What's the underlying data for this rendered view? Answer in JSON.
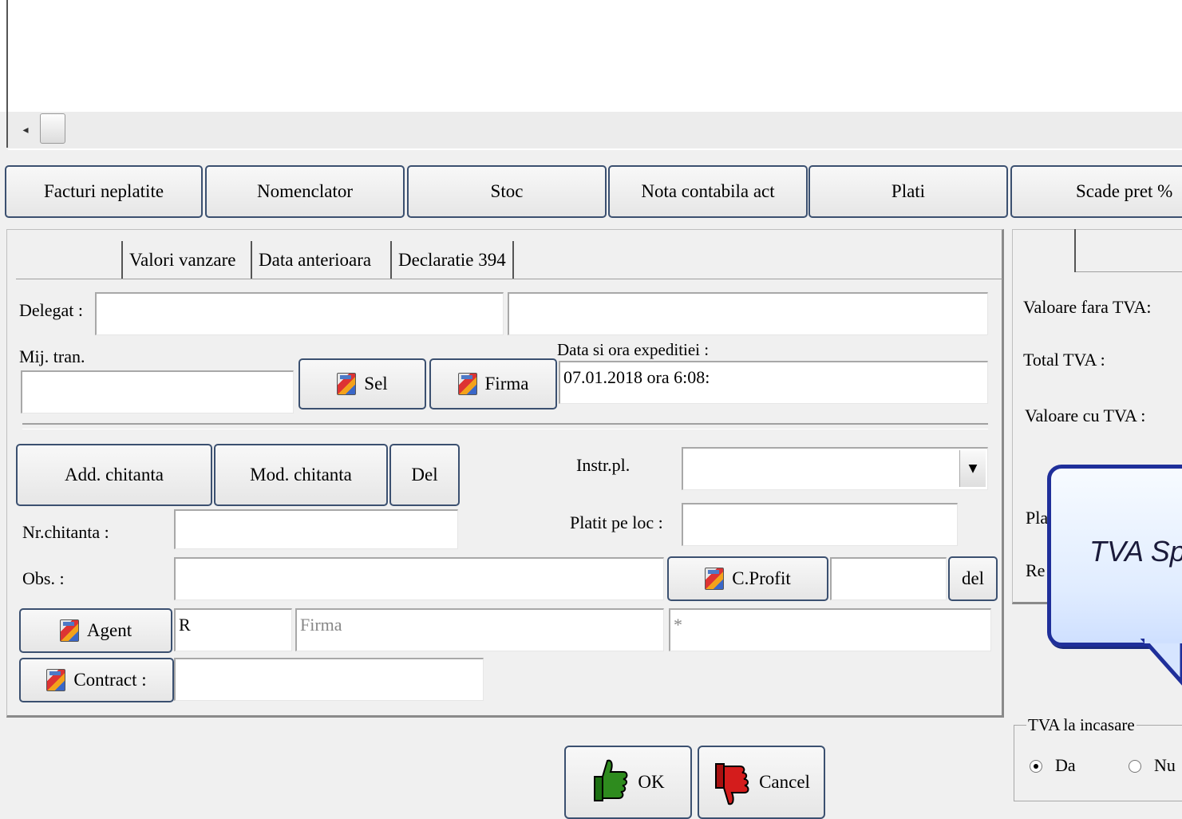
{
  "scrollbar": {
    "left_arrow_icon": "arrow-left-icon"
  },
  "toolbar": {
    "buttons": [
      "Facturi neplatite",
      "Nomenclator",
      "Stoc",
      "Nota contabila act",
      "Plati",
      "Scade pret %"
    ]
  },
  "tabs": [
    "Valori vanzare",
    "Data anterioara",
    "Declaratie 394"
  ],
  "form": {
    "delegat_label": "Delegat :",
    "delegat_value": "",
    "delegat_value2": "",
    "mij_tran_label": "Mij. tran.",
    "mij_tran_value": "",
    "sel_button": "Sel",
    "firma_button": "Firma",
    "data_expeditie_label": "Data si ora expeditiei :",
    "data_expeditie_value": "07.01.2018 ora 6:08:",
    "add_chitanta": "Add. chitanta",
    "mod_chitanta": "Mod. chitanta",
    "del_button": "Del",
    "instr_pl_label": "Instr.pl.",
    "instr_pl_value": "",
    "platit_pe_loc_label": "Platit pe loc :",
    "platit_pe_loc_value": "",
    "nr_chitanta_label": "Nr.chitanta :",
    "nr_chitanta_value": "",
    "obs_label": "Obs.   :",
    "obs_value": "",
    "cprofit_button": "C.Profit",
    "cprofit_value": "",
    "cprofit_del": "del",
    "agent_button": "Agent",
    "agent_code": "R",
    "agent_firma_placeholder": "Firma",
    "agent_extra": "*",
    "contract_button": "Contract :",
    "contract_value": ""
  },
  "summary": {
    "valoare_fara_tva": "Valoare fara TVA:",
    "total_tva": "Total TVA :",
    "valoare_cu_tva": "Valoare cu TVA :",
    "pla_partial": "Pla",
    "re_partial": "Re"
  },
  "tooltip": {
    "text": "TVA Sp"
  },
  "tva_incasare": {
    "title": "TVA la incasare",
    "options": [
      "Da",
      "Nu"
    ],
    "selected": "Da"
  },
  "actions": {
    "ok": "OK",
    "cancel": "Cancel"
  },
  "colors": {
    "button_border": "#3b5070",
    "tooltip_border": "#1f2f9a",
    "thumb_up": "#2e8b1e",
    "thumb_down": "#d41c1c"
  }
}
